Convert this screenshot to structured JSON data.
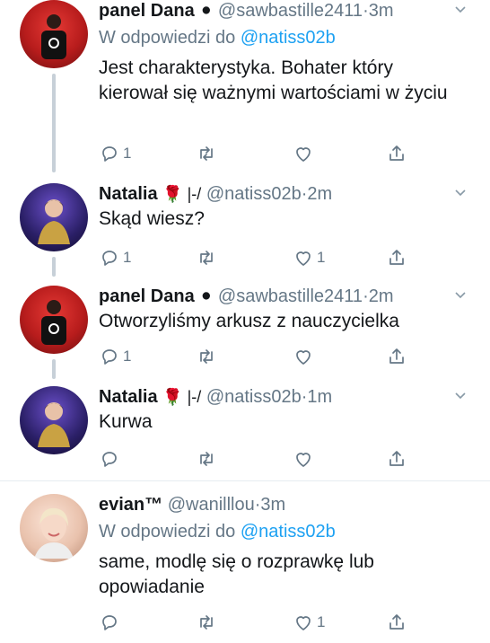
{
  "tweets": [
    {
      "name": "panel Dana",
      "badge": "⚫",
      "handle": "@sawbastille2411",
      "time": "3m",
      "reply_prefix": "W odpowiedzi do",
      "reply_mention": "@natiss02b",
      "text": "Jest charakterystyka. Bohater który kierował się ważnymi wartościami w życiu",
      "reply_count": "1",
      "like_count": ""
    },
    {
      "name": "Natalia",
      "badge": "🌹 |-/",
      "handle": "@natiss02b",
      "time": "2m",
      "text": "Skąd wiesz?",
      "reply_count": "1",
      "like_count": "1"
    },
    {
      "name": "panel Dana",
      "badge": "⚫",
      "handle": "@sawbastille2411",
      "time": "2m",
      "text": "Otworzyliśmy arkusz z nauczycielka",
      "reply_count": "1",
      "like_count": ""
    },
    {
      "name": "Natalia",
      "badge": "🌹 |-/",
      "handle": "@natiss02b",
      "time": "1m",
      "text": "Kurwa",
      "reply_count": "",
      "like_count": ""
    },
    {
      "name": "evian™",
      "badge": "",
      "handle": "@wanilllou",
      "time": "3m",
      "reply_prefix": "W odpowiedzi do",
      "reply_mention": "@natiss02b",
      "text": "same, modlę się o rozprawkę lub opowiadanie",
      "reply_count": "",
      "like_count": "1"
    }
  ],
  "separator": "·",
  "icons": [
    "reply-icon",
    "retweet-icon",
    "like-icon",
    "share-icon",
    "chevron-down-icon"
  ],
  "colors": {
    "text": "#14171a",
    "muted": "#657786",
    "link": "#1da1f2",
    "thread": "#c7d0d8"
  }
}
